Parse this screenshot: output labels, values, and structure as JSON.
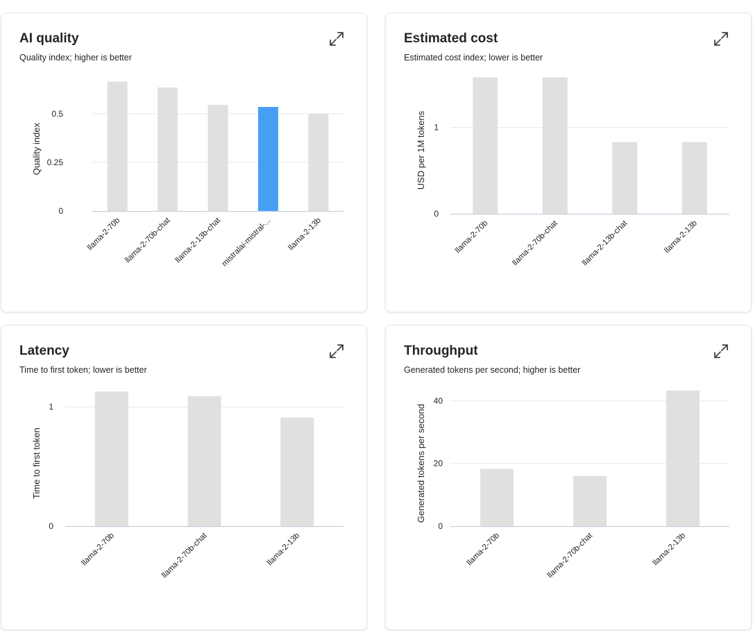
{
  "chart_data": [
    {
      "type": "bar",
      "title": "AI quality",
      "subtitle": "Quality index; higher is better",
      "ylabel": "Quality index",
      "xlabel": "",
      "categories": [
        "llama-2-70b",
        "llama-2-70b-chat",
        "llama-2-13b-chat",
        "mistralai-mistral-...",
        "llama-2-13b"
      ],
      "values": [
        0.665,
        0.635,
        0.545,
        0.535,
        0.5
      ],
      "highlight_index": 3,
      "yticks": [
        0,
        0.25,
        0.5
      ],
      "ytick_labels": [
        "0",
        "0.25",
        "0.5"
      ],
      "ylim": [
        0,
        0.71
      ],
      "grid": true,
      "colors": {
        "bar": "#e0e0e0",
        "highlight": "#479ef5"
      }
    },
    {
      "type": "bar",
      "title": "Estimated cost",
      "subtitle": "Estimated cost index; lower is better",
      "ylabel": "USD per 1M tokens",
      "xlabel": "",
      "categories": [
        "llama-2-70b",
        "llama-2-70b-chat",
        "llama-2-13b-chat",
        "llama-2-13b"
      ],
      "values": [
        1.58,
        1.58,
        0.83,
        0.83
      ],
      "highlight_index": -1,
      "yticks": [
        0,
        1
      ],
      "ytick_labels": [
        "0",
        "1"
      ],
      "ylim": [
        0,
        1.63
      ],
      "grid": true,
      "colors": {
        "bar": "#e0e0e0",
        "highlight": "#479ef5"
      }
    },
    {
      "type": "bar",
      "title": "Latency",
      "subtitle": "Time to first token; lower is better",
      "ylabel": "Time to first token",
      "xlabel": "",
      "categories": [
        "llama-2-70b",
        "llama-2-70b-chat",
        "llama-2-13b"
      ],
      "values": [
        1.13,
        1.09,
        0.91
      ],
      "highlight_index": -1,
      "yticks": [
        0,
        1
      ],
      "ytick_labels": [
        "0",
        "1"
      ],
      "ylim": [
        0,
        1.17
      ],
      "grid": true,
      "colors": {
        "bar": "#e0e0e0",
        "highlight": "#479ef5"
      }
    },
    {
      "type": "bar",
      "title": "Throughput",
      "subtitle": "Generated tokens per second; higher is better",
      "ylabel": "Generated tokens per second",
      "xlabel": "",
      "categories": [
        "llama-2-70b",
        "llama-2-70b-chat",
        "llama-2-13b"
      ],
      "values": [
        18.3,
        16.0,
        43.3
      ],
      "highlight_index": -1,
      "yticks": [
        0,
        20,
        40
      ],
      "ytick_labels": [
        "0",
        "20",
        "40"
      ],
      "ylim": [
        0,
        44.5
      ],
      "grid": true,
      "colors": {
        "bar": "#e0e0e0",
        "highlight": "#479ef5"
      }
    }
  ],
  "colors": {
    "bar": "#e0e0e0",
    "highlight": "#479ef5",
    "grid": "#e8e8e8",
    "axis": "#c8d1e0",
    "text": "#242424"
  },
  "icons": {
    "expand": "expand-icon"
  }
}
